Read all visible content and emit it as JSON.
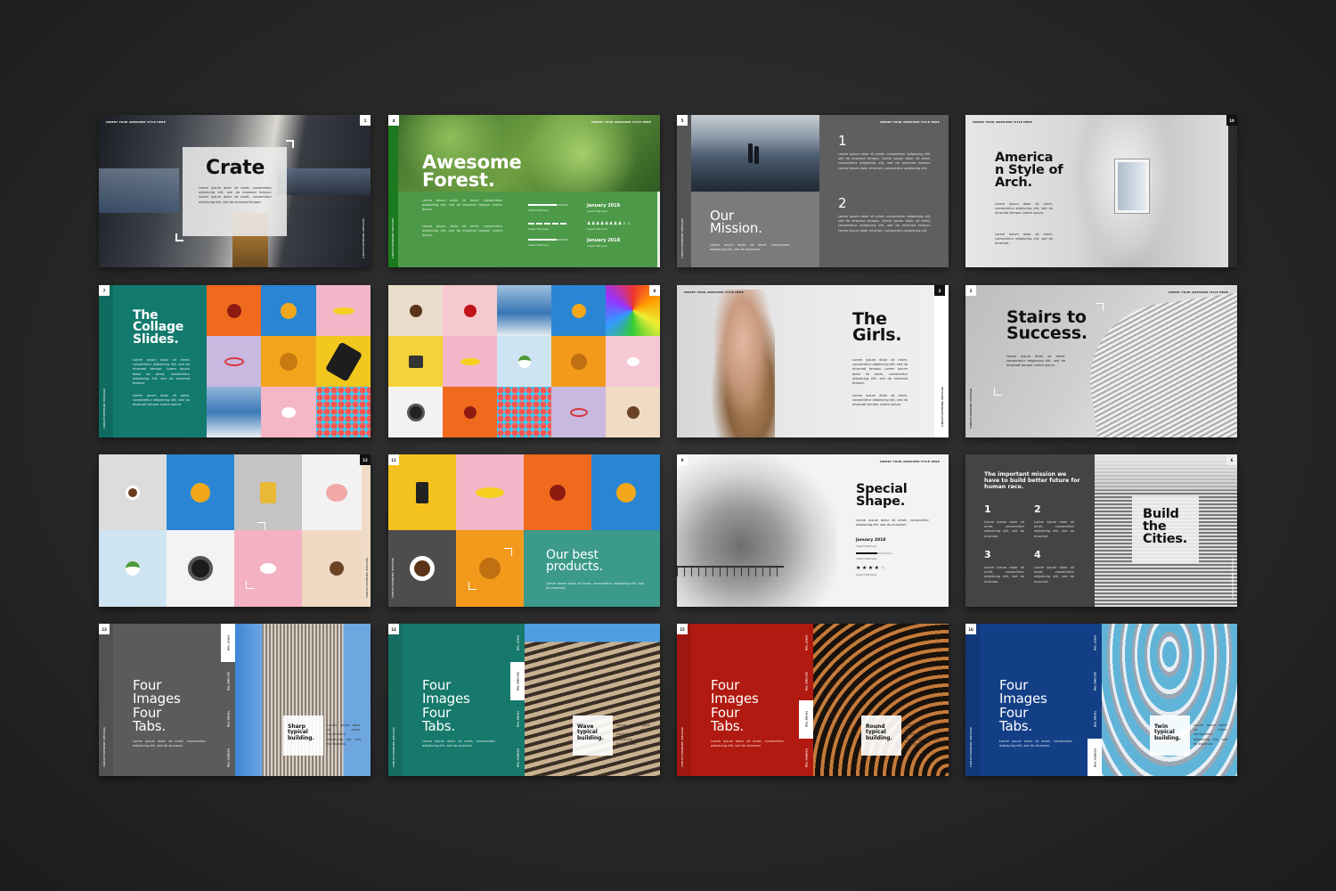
{
  "common": {
    "header": "INSERT YOUR AWESOME TITLE HERE",
    "brand": "CREATIVEMIND DESIGN",
    "lorem_long": "Lorem ipsum dolor sit amet, consectetur adipiscing elit, sed do eiusmod tempor. Lorem ipsum dolor sit amet, consectetur adipiscing elit, sed do eiusmod tempor. Lorem ipsum dolor sit amet, consectetur adipiscing elit.",
    "lorem_mid": "Lorem ipsum dolor sit amet, consectetur adipiscing elit, sed do eiusmod tempor. Lorem ipsum dolor sit amet, consectetur adipiscing elit, sed do eiusmod tempor.",
    "lorem_short": "Lorem ipsum dolor sit amet, consectetur adipiscing elit, sed do eiusmod tempor Lorem ipsum.",
    "lorem_tiny": "Lorem ipsum dolor sit amet, consectetur adipiscing elit, sed do eiusmod.",
    "insert_title": "Insert title here"
  },
  "slides": {
    "crate": {
      "num": "1",
      "title": "Crate"
    },
    "forest": {
      "num": "4",
      "title1": "Awesome",
      "title2": "Forest.",
      "date1": "January 2018",
      "date2": "January 2018",
      "progress": [
        0.7,
        0.75,
        0.7
      ],
      "rating_filled": 8,
      "rating_total": 10
    },
    "mission": {
      "num": "5",
      "title1": "Our",
      "title2": "Mission.",
      "n1": "1",
      "n2": "2"
    },
    "america": {
      "num": "10",
      "title1": "America",
      "title2": "n Style of",
      "title3": "Arch."
    },
    "collage": {
      "num": "7",
      "title1": "The",
      "title2": "Collage",
      "title3": "Slides."
    },
    "collage2": {
      "num": "8"
    },
    "girls": {
      "num": "3",
      "title1": "The",
      "title2": "Girls."
    },
    "stairs": {
      "num": "2",
      "title1": "Stairs to",
      "title2": "Success."
    },
    "grid12": {
      "num": "12"
    },
    "products": {
      "num": "11",
      "title1": "Our best",
      "title2": "products."
    },
    "special": {
      "num": "9",
      "title1": "Special",
      "title2": "Shape.",
      "date": "January 2018",
      "progress": 0.6,
      "rating_filled": 4,
      "rating_total": 5
    },
    "cities": {
      "num": "6",
      "mission": "The important mission we have to build better future for human race.",
      "n": [
        "1",
        "2",
        "3",
        "4"
      ],
      "title1": "Build",
      "title2": "the",
      "title3": "Cities."
    },
    "tabs": [
      {
        "num": "13",
        "color": "#5b5b5b",
        "caption1": "Sharp",
        "caption2": "typical",
        "caption3": "building."
      },
      {
        "num": "14",
        "color": "#16796b",
        "caption1": "Wave",
        "caption2": "typical",
        "caption3": "building."
      },
      {
        "num": "15",
        "color": "#b11a10",
        "caption1": "Round",
        "caption2": "typical",
        "caption3": "building."
      },
      {
        "num": "16",
        "color": "#133f87",
        "caption1": "Twin",
        "caption2": "typical",
        "caption3": "building."
      }
    ],
    "tab_title": [
      "Four",
      "Images",
      "Four",
      "Tabs."
    ],
    "tab_labels": [
      "FIRST TAB",
      "SECOND TAB",
      "THIRD TAB",
      "FOURTH TAB"
    ]
  }
}
